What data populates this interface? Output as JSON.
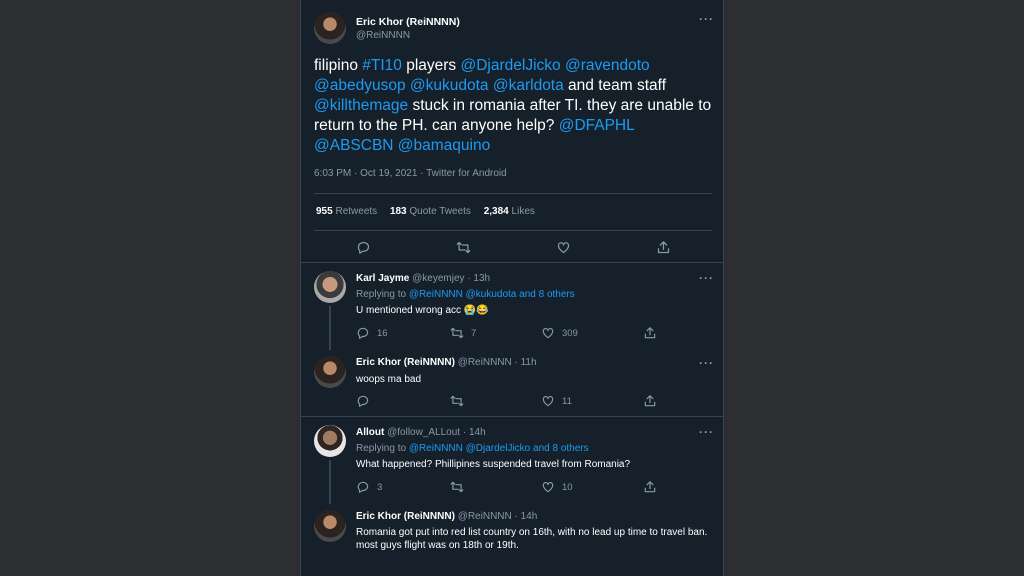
{
  "main": {
    "author_name": "Eric Khor (ReiNNNN)",
    "author_handle": "@ReiNNNN",
    "text_parts": [
      {
        "t": "filipino ",
        "link": false
      },
      {
        "t": "#TI10",
        "link": true
      },
      {
        "t": " players ",
        "link": false
      },
      {
        "t": "@DjardelJicko",
        "link": true
      },
      {
        "t": " ",
        "link": false
      },
      {
        "t": "@ravendoto",
        "link": true
      },
      {
        "t": " ",
        "link": false
      },
      {
        "t": "@abedyusop",
        "link": true
      },
      {
        "t": " ",
        "link": false
      },
      {
        "t": "@kukudota",
        "link": true
      },
      {
        "t": " ",
        "link": false
      },
      {
        "t": "@karldota",
        "link": true
      },
      {
        "t": " and team staff ",
        "link": false
      },
      {
        "t": "@killthemage",
        "link": true
      },
      {
        "t": " stuck in romania after TI. they are unable to return to the PH. can anyone help? ",
        "link": false
      },
      {
        "t": "@DFAPHL",
        "link": true
      },
      {
        "t": " ",
        "link": false
      },
      {
        "t": "@ABSCBN",
        "link": true
      },
      {
        "t": " ",
        "link": false
      },
      {
        "t": "@bamaquino",
        "link": true
      }
    ],
    "meta": "6:03 PM · Oct 19, 2021 · Twitter for Android",
    "retweets_count": "955",
    "retweets_label": "Retweets",
    "quotes_count": "183",
    "quotes_label": "Quote Tweets",
    "likes_count": "2,384",
    "likes_label": "Likes"
  },
  "replies": [
    {
      "name": "Karl Jayme",
      "meta": "@keyemjey · 13h",
      "replying_prefix": "Replying to ",
      "replying_links": "@ReiNNNN @kukudota and 8 others",
      "text": "U mentioned wrong acc 😭😂",
      "reply_count": "16",
      "retweet_count": "7",
      "like_count": "309"
    },
    {
      "name": "Eric Khor (ReiNNNN)",
      "meta": "@ReiNNNN · 11h",
      "text": "woops ma bad",
      "reply_count": "",
      "retweet_count": "",
      "like_count": "11"
    },
    {
      "name": "Allout",
      "meta": "@follow_ALLout · 14h",
      "replying_prefix": "Replying to ",
      "replying_links": "@ReiNNNN @DjardelJicko and 8 others",
      "text": "What happened? Phillipines suspended travel from Romania?",
      "reply_count": "3",
      "retweet_count": "",
      "like_count": "10"
    },
    {
      "name": "Eric Khor (ReiNNNN)",
      "meta": "@ReiNNNN · 14h",
      "text": "Romania got put into red list country on 16th, with no lead up time to travel ban. most guys flight was on 18th or 19th."
    }
  ],
  "icons": {
    "more": "more-horizontal-icon",
    "reply": "reply-icon",
    "retweet": "retweet-icon",
    "like": "heart-icon",
    "share": "share-icon"
  }
}
